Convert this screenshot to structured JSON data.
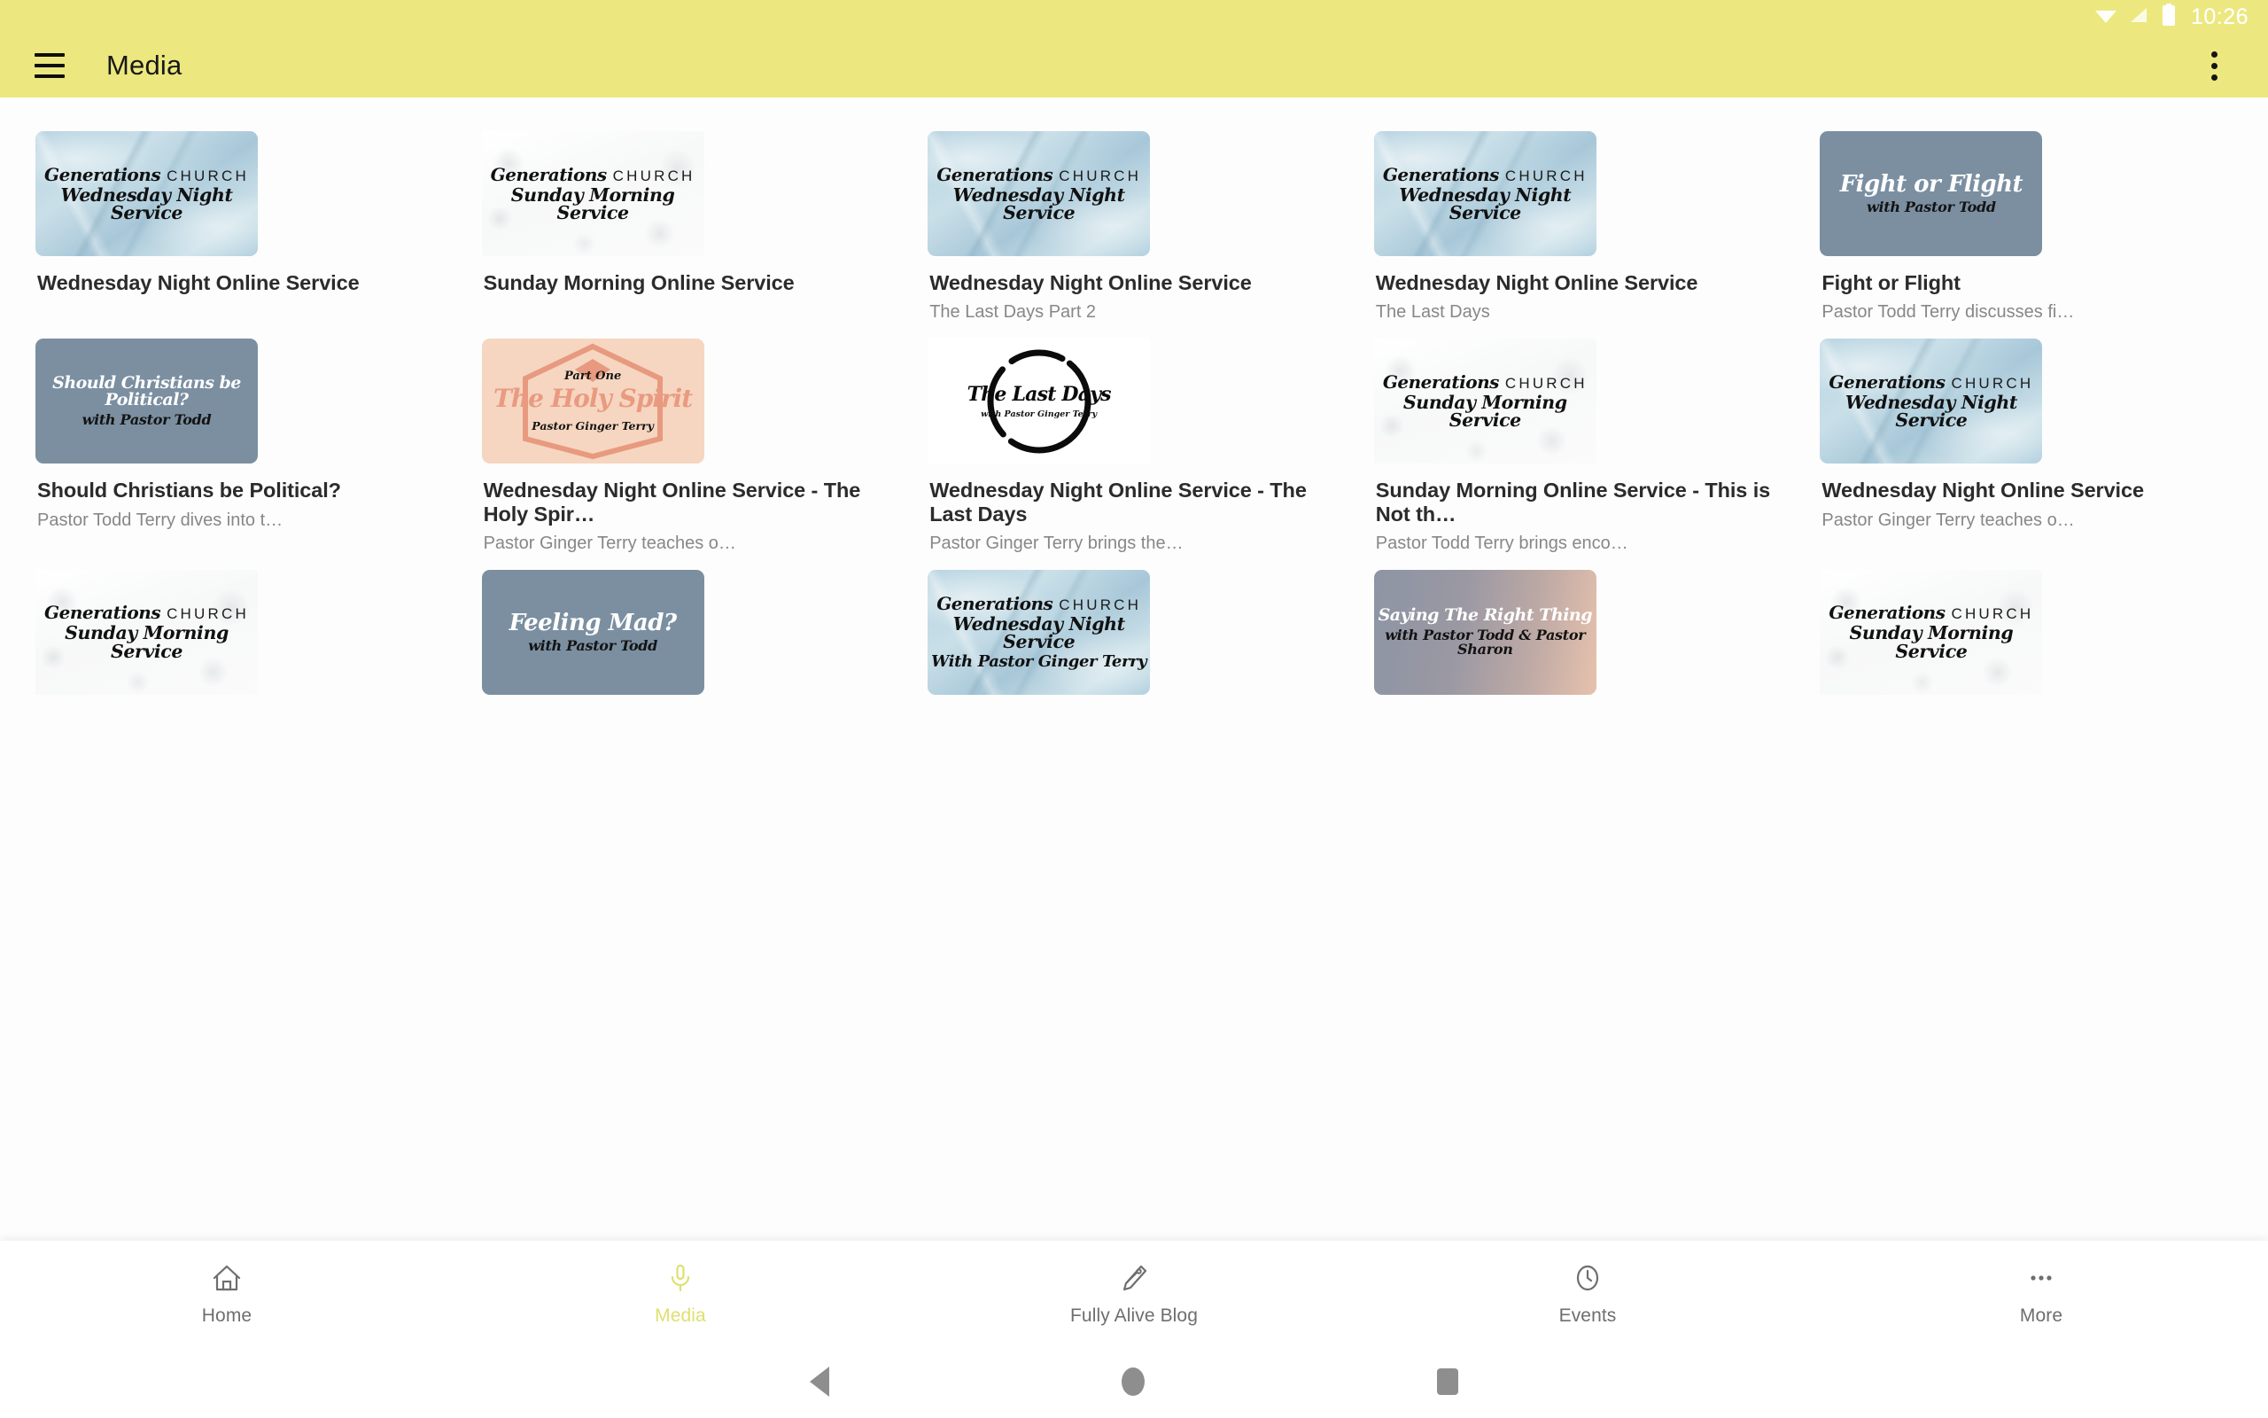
{
  "status_bar": {
    "time": "10:26",
    "icons": [
      "wifi-icon",
      "cellular-signal-icon",
      "battery-icon"
    ]
  },
  "app_bar": {
    "menu_icon": "hamburger-menu-icon",
    "title": "Media",
    "overflow_icon": "overflow-menu-icon",
    "background_color": "#ece87f"
  },
  "media_grid": {
    "items": [
      {
        "title": "Wednesday Night Online Service",
        "subtitle": "",
        "thumb_style": "art-wm",
        "thumb_type": "generations-two-line",
        "art": {
          "line1": "Generations",
          "caps": "CHURCH",
          "line2": "Wednesday Night Service"
        }
      },
      {
        "title": "Sunday Morning Online Service",
        "subtitle": "",
        "thumb_style": "art-white",
        "thumb_type": "generations-two-line",
        "art": {
          "line1": "Generations",
          "caps": "CHURCH",
          "line2": "Sunday Morning Service"
        }
      },
      {
        "title": "Wednesday Night Online Service",
        "subtitle": "The Last Days Part 2",
        "thumb_style": "art-wm",
        "thumb_type": "generations-two-line",
        "art": {
          "line1": "Generations",
          "caps": "CHURCH",
          "line2": "Wednesday Night Service"
        }
      },
      {
        "title": "Wednesday Night Online Service",
        "subtitle": "The Last Days",
        "thumb_style": "art-wm",
        "thumb_type": "generations-two-line",
        "art": {
          "line1": "Generations",
          "caps": "CHURCH",
          "line2": "Wednesday Night Service"
        }
      },
      {
        "title": "Fight or Flight",
        "subtitle": "Pastor Todd Terry discusses fi…",
        "thumb_style": "art-slate",
        "thumb_type": "series-title",
        "art": {
          "main": "Fight or Flight",
          "with": "with Pastor Todd"
        }
      },
      {
        "title": "Should Christians be Political?",
        "subtitle": "Pastor Todd Terry dives into t…",
        "thumb_style": "art-slate",
        "thumb_type": "series-title-small",
        "art": {
          "main": "Should Christians be Political?",
          "with": "with Pastor Todd"
        }
      },
      {
        "title": "Wednesday Night Online Service - The Holy Spir…",
        "subtitle": "Pastor Ginger Terry teaches o…",
        "thumb_style": "art-peach",
        "thumb_type": "holy-spirit-hex",
        "art": {
          "part": "Part One",
          "main": "The Holy Spirit",
          "name": "Pastor Ginger Terry"
        }
      },
      {
        "title": "Wednesday Night Online Service - The Last Days",
        "subtitle": "Pastor Ginger Terry brings the…",
        "thumb_style": "art-circle",
        "thumb_type": "last-days-circle",
        "art": {
          "main": "The Last Days",
          "with": "with Pastor Ginger Terry"
        }
      },
      {
        "title": "Sunday Morning Online Service - This is Not th…",
        "subtitle": "Pastor Todd Terry brings enco…",
        "thumb_style": "art-white",
        "thumb_type": "generations-two-line",
        "art": {
          "line1": "Generations",
          "caps": "CHURCH",
          "line2": "Sunday Morning Service"
        }
      },
      {
        "title": "Wednesday Night Online Service",
        "subtitle": "Pastor Ginger Terry teaches o…",
        "thumb_style": "art-wm",
        "thumb_type": "generations-two-line",
        "art": {
          "line1": "Generations",
          "caps": "CHURCH",
          "line2": "Wednesday Night Service"
        }
      },
      {
        "title": "",
        "subtitle": "",
        "thumb_style": "art-white",
        "thumb_type": "generations-two-line",
        "art": {
          "line1": "Generations",
          "caps": "CHURCH",
          "line2": "Sunday Morning Service"
        }
      },
      {
        "title": "",
        "subtitle": "",
        "thumb_style": "art-slate",
        "thumb_type": "series-title",
        "art": {
          "main": "Feeling Mad?",
          "with": "with Pastor Todd"
        }
      },
      {
        "title": "",
        "subtitle": "",
        "thumb_style": "art-wm",
        "thumb_type": "generations-three-line",
        "art": {
          "line1": "Generations",
          "caps": "CHURCH",
          "line2": "Wednesday Night Service",
          "line3": "With Pastor Ginger Terry"
        }
      },
      {
        "title": "",
        "subtitle": "",
        "thumb_style": "art-gradient",
        "thumb_type": "series-title-small",
        "art": {
          "main": "Saying The Right Thing",
          "with": "with Pastor Todd & Pastor Sharon"
        }
      },
      {
        "title": "",
        "subtitle": "",
        "thumb_style": "art-white",
        "thumb_type": "generations-two-line",
        "art": {
          "line1": "Generations",
          "caps": "CHURCH",
          "line2": "Sunday Morning Service"
        }
      }
    ]
  },
  "bottom_nav": {
    "active_color": "#dfe06e",
    "inactive_color": "#6e6e6e",
    "items": [
      {
        "label": "Home",
        "icon": "home-icon",
        "active": false
      },
      {
        "label": "Media",
        "icon": "microphone-icon",
        "active": true
      },
      {
        "label": "Fully Alive Blog",
        "icon": "pen-nib-icon",
        "active": false
      },
      {
        "label": "Events",
        "icon": "clock-icon",
        "active": false
      },
      {
        "label": "More",
        "icon": "more-dots-icon",
        "active": false
      }
    ]
  },
  "system_nav": {
    "back": "back-triangle-icon",
    "home": "home-circle-icon",
    "recents": "recents-square-icon"
  }
}
